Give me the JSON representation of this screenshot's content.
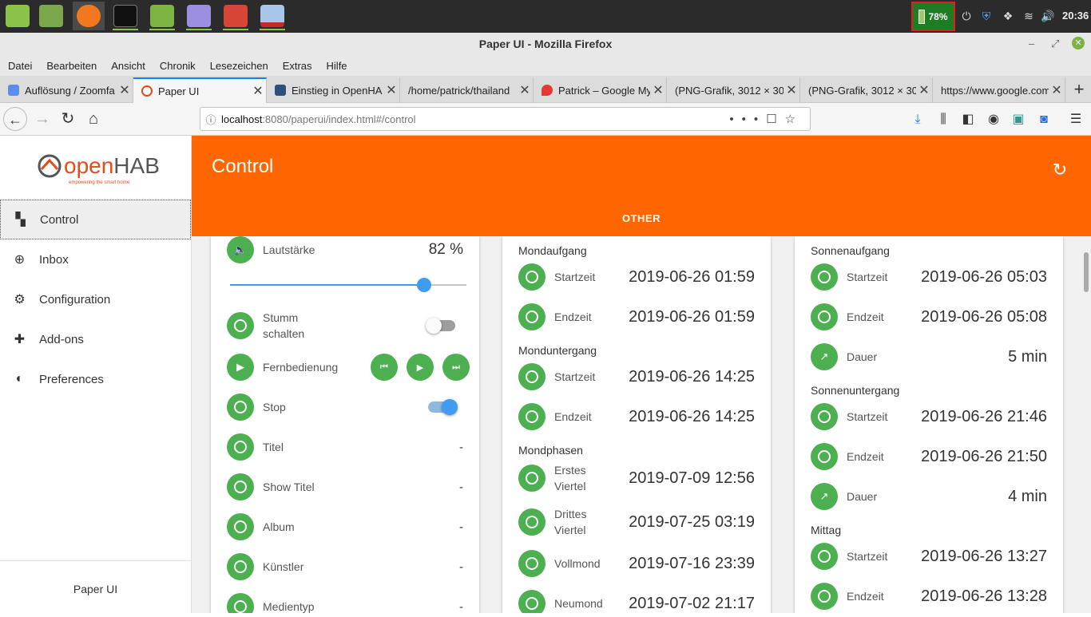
{
  "taskbar": {
    "battery": "78%",
    "clock": "20:36"
  },
  "window": {
    "title": "Paper UI - Mozilla Firefox"
  },
  "menu": [
    "Datei",
    "Bearbeiten",
    "Ansicht",
    "Chronik",
    "Lesezeichen",
    "Extras",
    "Hilfe"
  ],
  "tabs": [
    {
      "label": "Auflösung / Zoomfa",
      "color": "#5b8def"
    },
    {
      "label": "Paper UI",
      "color": "#e64a19"
    },
    {
      "label": "Einstieg in OpenHA",
      "color": "#2c4f7c"
    },
    {
      "label": "/home/patrick/thailand",
      "color": "#dcdcdc"
    },
    {
      "label": "Patrick – Google My",
      "color": "#e53935"
    },
    {
      "label": "(PNG-Grafik, 3012 × 30",
      "color": "#dcdcdc"
    },
    {
      "label": "(PNG-Grafik, 3012 × 30",
      "color": "#dcdcdc"
    },
    {
      "label": "https://www.google.com",
      "color": "#dcdcdc"
    }
  ],
  "url": {
    "host": "localhost",
    "path": ":8080/paperui/index.html#/control"
  },
  "sidebar": {
    "logo_o": "open",
    "logo_h": "HAB",
    "logo_tag": "empowering the smart home",
    "items": [
      {
        "label": "Control",
        "icon": "dashboard-icon"
      },
      {
        "label": "Inbox",
        "icon": "add-circle-icon"
      },
      {
        "label": "Configuration",
        "icon": "gear-icon"
      },
      {
        "label": "Add-ons",
        "icon": "puzzle-icon"
      },
      {
        "label": "Preferences",
        "icon": "brightness-icon"
      }
    ],
    "footer": "Paper UI"
  },
  "header": {
    "title": "Control",
    "tab": "OTHER"
  },
  "media": {
    "volume_label": "Lautstärke",
    "volume_value": "82 %",
    "volume_level": 0.82,
    "mute_label": "Stumm schalten",
    "remote_label": "Fernbedienung",
    "stop_label": "Stop",
    "titel_label": "Titel",
    "titel_value": "-",
    "show_titel_label": "Show Titel",
    "show_titel_value": "-",
    "album_label": "Album",
    "album_value": "-",
    "artist_label": "Künstler",
    "artist_value": "-",
    "mediatype_label": "Medientyp",
    "mediatype_value": "-"
  },
  "moon": {
    "rise_group": "Mondaufgang",
    "rise_start_label": "Startzeit",
    "rise_start": "2019-06-26 01:59",
    "rise_end_label": "Endzeit",
    "rise_end": "2019-06-26 01:59",
    "set_group": "Monduntergang",
    "set_start_label": "Startzeit",
    "set_start": "2019-06-26 14:25",
    "set_end_label": "Endzeit",
    "set_end": "2019-06-26 14:25",
    "phase_group": "Mondphasen",
    "first_label_1": "Erstes",
    "first_label_2": "Viertel",
    "first": "2019-07-09 12:56",
    "third_label_1": "Drittes",
    "third_label_2": "Viertel",
    "third": "2019-07-25 03:19",
    "full_label": "Vollmond",
    "full": "2019-07-16 23:39",
    "new_label": "Neumond",
    "new": "2019-07-02 21:17"
  },
  "sun": {
    "rise_group": "Sonnenaufgang",
    "rise_start_label": "Startzeit",
    "rise_start": "2019-06-26 05:03",
    "rise_end_label": "Endzeit",
    "rise_end": "2019-06-26 05:08",
    "rise_dur_label": "Dauer",
    "rise_dur": "5 min",
    "set_group": "Sonnenuntergang",
    "set_start_label": "Startzeit",
    "set_start": "2019-06-26 21:46",
    "set_end_label": "Endzeit",
    "set_end": "2019-06-26 21:50",
    "set_dur_label": "Dauer",
    "set_dur": "4 min",
    "noon_group": "Mittag",
    "noon_start_label": "Startzeit",
    "noon_start": "2019-06-26 13:27",
    "noon_end_label": "Endzeit",
    "noon_end": "2019-06-26 13:28"
  }
}
